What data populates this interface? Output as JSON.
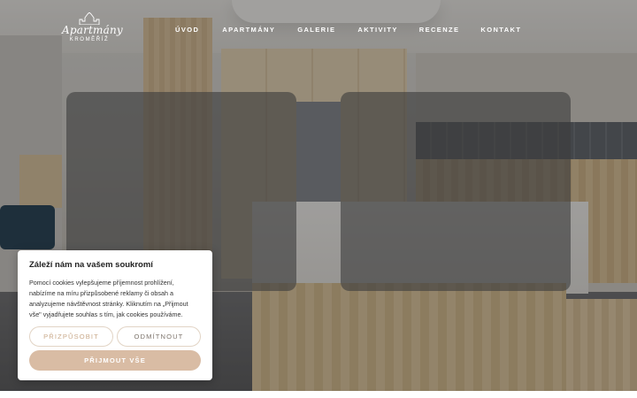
{
  "logo": {
    "title": "Apartmány",
    "subtitle": "KROMĚŘÍŽ"
  },
  "nav": {
    "items": [
      {
        "label": "ÚVOD"
      },
      {
        "label": "APARTMÁNY"
      },
      {
        "label": "GALERIE"
      },
      {
        "label": "AKTIVITY"
      },
      {
        "label": "RECENZE"
      },
      {
        "label": "KONTAKT"
      }
    ]
  },
  "cookie": {
    "title": "Záleží nám na vašem soukromí",
    "text": "Pomocí cookies vylepšujeme příjemnost prohlížení, nabízíme na míru přizpůsobené reklamy či obsah a analyzujeme návštěvnost stránky. Kliknutím na „Přijmout vše\" vyjadřujete souhlas s tím, jak cookies používáme.",
    "customize_label": "PŘIZPŮSOBIT",
    "reject_label": "ODMÍTNOUT",
    "accept_label": "PŘIJMOUT VŠE"
  },
  "colors": {
    "accent": "#d9bca4",
    "accent_text": "#c9a98a",
    "panel_overlay": "#3e3e3e"
  }
}
